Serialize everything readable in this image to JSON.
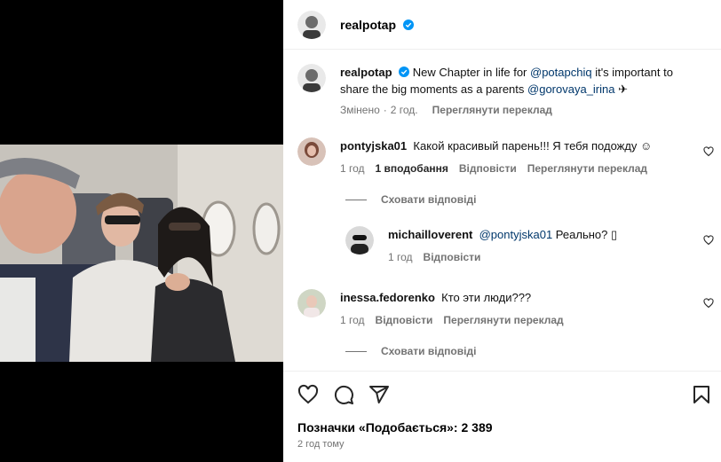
{
  "post": {
    "username": "realpotap",
    "caption_user": "realpotap",
    "caption_text_1": "New Chapter in life for ",
    "caption_mention_1": "@potapchiq",
    "caption_text_2": " it's important to share the big moments as a parents ",
    "caption_mention_2": "@gorovaya_irina",
    "caption_emoji": " ✈",
    "caption_meta": {
      "edited": "Змінено",
      "separator": "·",
      "time": "2 год.",
      "translate": "Переглянути переклад"
    }
  },
  "comments": [
    {
      "user": "pontyjska01",
      "text": "Какой красивый парень!!! Я тебя подожду ☺",
      "time": "1 год",
      "likes": "1 вподобання",
      "reply": "Відповісти",
      "translate": "Переглянути переклад",
      "hide_replies": "Сховати відповіді",
      "replies": [
        {
          "user": "michailloverent",
          "mention": "@pontyjska01",
          "text": " Реально? ▯",
          "time": "1 год",
          "reply": "Відповісти"
        }
      ]
    },
    {
      "user": "inessa.fedorenko",
      "text": "Кто эти люди???",
      "time": "1 год",
      "reply": "Відповісти",
      "translate": "Переглянути переклад",
      "hide_replies": "Сховати відповіді"
    }
  ],
  "footer": {
    "likes_label": "Позначки «Подобається»: 2 389",
    "time_ago": "2 год тому"
  },
  "icons": {
    "like": "heart-icon",
    "comment": "comment-icon",
    "share": "share-icon",
    "save": "bookmark-icon",
    "verified": "verified-badge-icon"
  },
  "colors": {
    "verified": "#0095f6",
    "mention": "#00376b",
    "secondary_text": "#737373"
  }
}
